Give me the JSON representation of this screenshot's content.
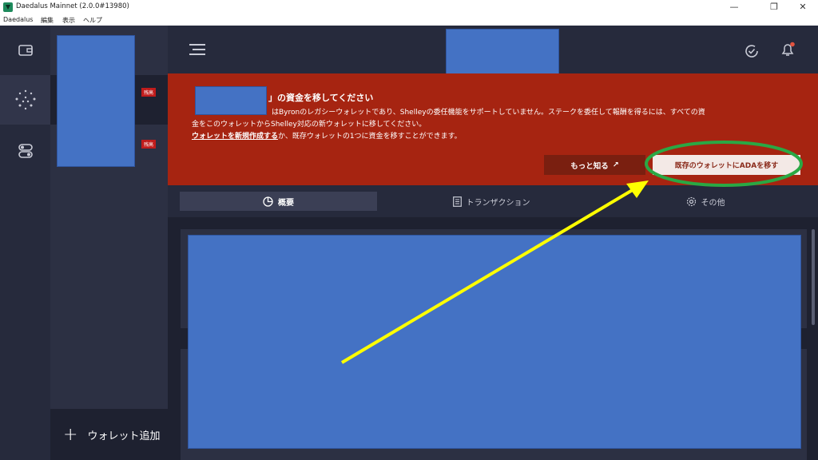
{
  "window": {
    "title": "Daedalus Mainnet (2.0.0#13980)",
    "controls": {
      "minimize": "—",
      "maximize": "❐",
      "close": "✕"
    }
  },
  "menu": [
    "Daedalus",
    "編集",
    "表示",
    "ヘルプ"
  ],
  "sidebar": {
    "wallet_tag": "残高",
    "add_wallet": "ウォレット追加"
  },
  "notice": {
    "title_suffix": "」の資金を移してください",
    "body_line1": "はByronのレガシーウォレットであり、Shelleyの委任機能をサポートしていません。ステークを委任して報酬を得るには、すべての資",
    "body_line2": "金をこのウォレットからShelley対応の新ウォレットに移してください。",
    "link": "ウォレットを新規作成する",
    "body_line3": "か、既存ウォレットの1つに資金を移すことができます。",
    "learn_more": "もっと知る",
    "move_button": "既存のウォレットにADAを移す"
  },
  "tabs": [
    {
      "label": "概要"
    },
    {
      "label": "トランザクション"
    },
    {
      "label": "その他"
    }
  ],
  "colors": {
    "notice_bg": "#a62411",
    "redaction": "#4472c4",
    "annotation_circle": "#2aa844",
    "annotation_arrow": "#ffff00"
  }
}
